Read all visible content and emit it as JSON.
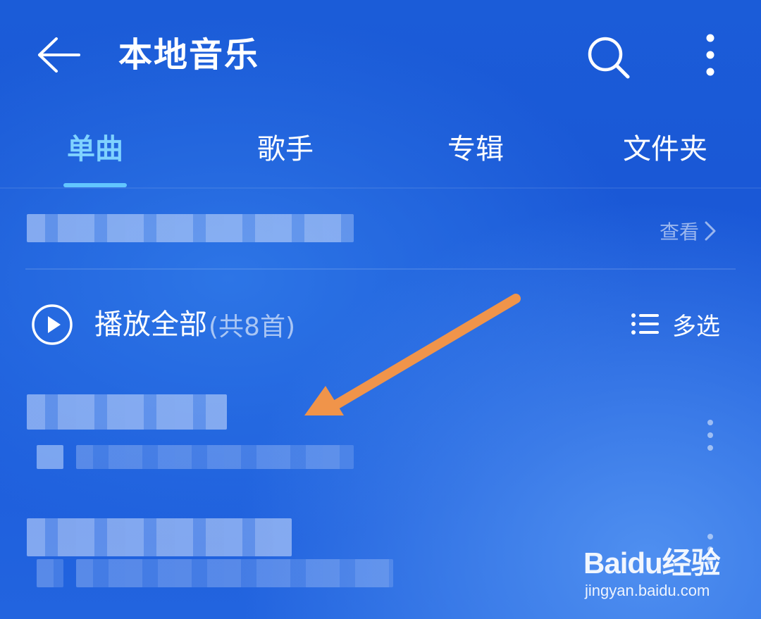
{
  "header": {
    "title": "本地音乐",
    "back_icon": "arrow-left-icon",
    "search_icon": "search-icon",
    "more_icon": "more-vertical-icon"
  },
  "tabs": [
    {
      "label": "单曲",
      "active": true
    },
    {
      "label": "歌手",
      "active": false
    },
    {
      "label": "专辑",
      "active": false
    },
    {
      "label": "文件夹",
      "active": false
    }
  ],
  "banner": {
    "view_label": "查看"
  },
  "play_all": {
    "label": "播放全部",
    "count": "(共8首)"
  },
  "multi_select": {
    "label": "多选"
  },
  "watermark": {
    "logo": "Baidu经验",
    "url": "jingyan.baidu.com"
  },
  "colors": {
    "background": "#1b5cd8",
    "tab_active": "#7fd2ff",
    "indicator": "#62c6ff",
    "annotation_arrow": "#f0944a"
  }
}
